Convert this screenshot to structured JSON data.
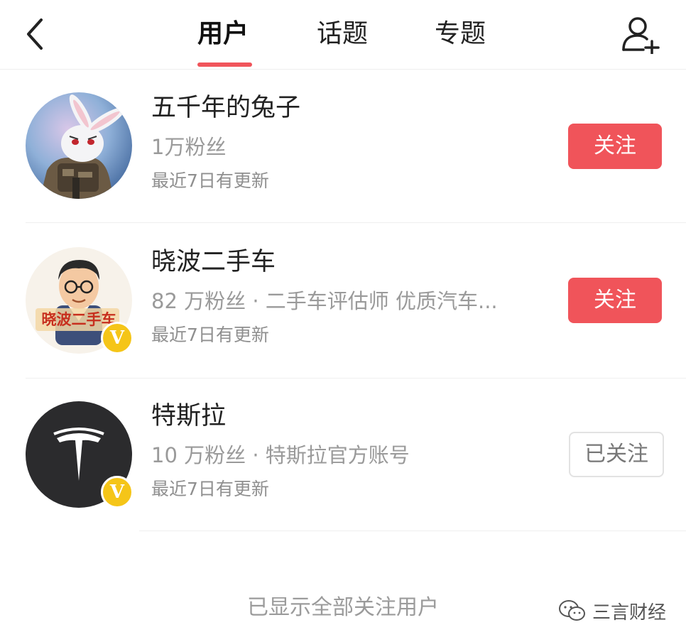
{
  "header": {
    "tabs": [
      {
        "label": "用户",
        "active": true
      },
      {
        "label": "话题",
        "active": false
      },
      {
        "label": "专题",
        "active": false
      }
    ],
    "accent_color": "#f0545a",
    "back_icon": "chevron-left-icon",
    "add_user_icon": "add-user-icon"
  },
  "users": [
    {
      "name": "五千年的兔子",
      "meta": "1万粉丝",
      "update": "最近7日有更新",
      "button": "关注",
      "followed": false,
      "verified": false
    },
    {
      "name": "晓波二手车",
      "meta": "82 万粉丝 · 二手车评估师 优质汽车...",
      "update": "最近7日有更新",
      "button": "关注",
      "followed": false,
      "verified": true,
      "avatar_text": "晓波二手车"
    },
    {
      "name": "特斯拉",
      "meta": "10 万粉丝 · 特斯拉官方账号",
      "update": "最近7日有更新",
      "button": "已关注",
      "followed": true,
      "verified": true
    }
  ],
  "footer": {
    "text": "已显示全部关注用户"
  },
  "watermark": {
    "text": "三言财经",
    "icon": "wechat-icon"
  }
}
